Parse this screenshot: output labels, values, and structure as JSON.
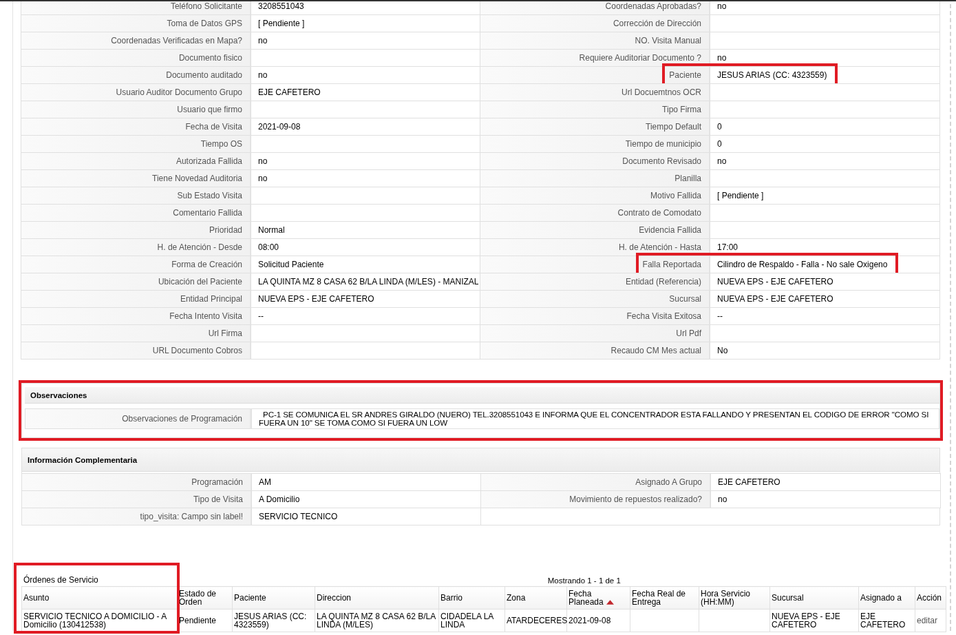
{
  "detail_rows": [
    [
      {
        "label": "Teléfono Solicitante",
        "value": "3208551043",
        "highlighted": false
      },
      {
        "label": "Coordenadas Aprobadas?",
        "value": "no",
        "highlighted": false
      }
    ],
    [
      {
        "label": "Toma de Datos GPS",
        "value": "[ Pendiente ]",
        "highlighted": false
      },
      {
        "label": "Corrección de Dirección",
        "highlighted": false
      }
    ],
    [
      {
        "label": "Coordenadas Verificadas en Mapa?",
        "value": "no",
        "highlighted": false
      },
      {
        "label": "NO. Visita Manual",
        "highlighted": false
      }
    ],
    [
      {
        "label": "Documento fisico",
        "highlighted": false
      },
      {
        "label": "Requiere Auditoriar Documento ?",
        "value": "no",
        "highlighted": false
      }
    ],
    [
      {
        "label": "Documento auditado",
        "value": "no",
        "highlighted": false
      },
      {
        "label": "Paciente",
        "value": "JESUS ARIAS (CC: 4323559)",
        "highlighted": true
      }
    ],
    [
      {
        "label": "Usuario Auditor Documento Grupo",
        "value": "EJE CAFETERO",
        "highlighted": false
      },
      {
        "label": "Url Docuemtnos OCR",
        "highlighted": false
      }
    ],
    [
      {
        "label": "Usuario que firmo",
        "highlighted": false
      },
      {
        "label": "Tipo Firma",
        "highlighted": false
      }
    ],
    [
      {
        "label": "Fecha de Visita",
        "value": "2021-09-08",
        "highlighted": false
      },
      {
        "label": "Tiempo Default",
        "value": "0",
        "highlighted": false
      }
    ],
    [
      {
        "label": "Tiempo OS",
        "highlighted": false
      },
      {
        "label": "Tiempo de municipio",
        "value": "0",
        "highlighted": false
      }
    ],
    [
      {
        "label": "Autorizada Fallida",
        "value": "no",
        "highlighted": false
      },
      {
        "label": "Documento Revisado",
        "value": "no",
        "highlighted": false
      }
    ],
    [
      {
        "label": "Tiene Novedad Auditoria",
        "value": "no",
        "highlighted": false
      },
      {
        "label": "Planilla",
        "highlighted": false
      }
    ],
    [
      {
        "label": "Sub Estado Visita",
        "highlighted": false
      },
      {
        "label": "Motivo Fallida",
        "value": "[ Pendiente ]",
        "highlighted": false
      }
    ],
    [
      {
        "label": "Comentario Fallida",
        "highlighted": false
      },
      {
        "label": "Contrato de Comodato",
        "highlighted": false
      }
    ],
    [
      {
        "label": "Prioridad",
        "value": "Normal",
        "highlighted": false
      },
      {
        "label": "Evidencia Fallida",
        "highlighted": false
      }
    ],
    [
      {
        "label": "H. de Atención - Desde",
        "value": "08:00",
        "highlighted": false
      },
      {
        "label": "H. de Atención - Hasta",
        "value": "17:00",
        "highlighted": false
      }
    ],
    [
      {
        "label": "Forma de Creación",
        "value": "Solicitud Paciente",
        "highlighted": false
      },
      {
        "label": "Falla Reportada",
        "value": "Cilindro de Respaldo - Falla - No sale Oxigeno",
        "highlighted": true
      }
    ],
    [
      {
        "label": "Ubicación del Paciente",
        "value": "LA QUINTA MZ 8 CASA 62 B/LA LINDA (M/LES) - MANIZAL",
        "highlighted": false
      },
      {
        "label": "Entidad (Referencia)",
        "value": "NUEVA EPS - EJE CAFETERO",
        "highlighted": false
      }
    ],
    [
      {
        "label": "Entidad Principal",
        "value": "NUEVA EPS - EJE CAFETERO",
        "highlighted": false
      },
      {
        "label": "Sucursal",
        "value": "NUEVA EPS - EJE CAFETERO",
        "highlighted": false
      }
    ],
    [
      {
        "label": "Fecha Intento Visita",
        "value": "--",
        "highlighted": false
      },
      {
        "label": "Fecha Visita Exitosa",
        "value": "--",
        "highlighted": false
      }
    ],
    [
      {
        "label": "Url Firma",
        "highlighted": false
      },
      {
        "label": "Url Pdf",
        "highlighted": false
      }
    ],
    [
      {
        "label": "URL Documento Cobros",
        "highlighted": false
      },
      {
        "label": "Recaudo CM Mes actual",
        "value": "No",
        "highlighted": false
      }
    ]
  ],
  "observaciones": {
    "title": "Observaciones",
    "highlighted": true,
    "label": "Observaciones de Programación",
    "value": "PC-1 SE COMUNICA EL SR ANDRES GIRALDO (NUERO) TEL.3208551043 E INFORMA QUE EL CONCENTRADOR ESTA FALLANDO Y PRESENTAN EL CODIGO DE ERROR \"COMO SI FUERA UN 10\" SE TOMA COMO SI FUERA UN LOW"
  },
  "informacion_complementaria": {
    "title": "Información Complementaria",
    "rows": [
      [
        {
          "label": "Programación",
          "value": "AM"
        },
        {
          "label": "Asignado A Grupo",
          "value": "EJE CAFETERO"
        }
      ],
      [
        {
          "label": "Tipo de Visita",
          "value": "A Domicilio"
        },
        {
          "label": "Movimiento de repuestos realizado?",
          "value": "no"
        }
      ],
      [
        {
          "label": "tipo_visita: Campo sin label!",
          "value": "SERVICIO TECNICO"
        }
      ]
    ]
  },
  "ordenes": {
    "title": "Órdenes de Servicio",
    "highlighted": true,
    "pager": "Mostrando 1 - 1 de 1",
    "columns": [
      {
        "label": "Asunto",
        "sorted": false
      },
      {
        "label": "Estado de Orden",
        "sorted": false
      },
      {
        "label": "Paciente",
        "sorted": false
      },
      {
        "label": "Direccion",
        "sorted": false
      },
      {
        "label": "Barrio",
        "sorted": false
      },
      {
        "label": "Zona",
        "sorted": false
      },
      {
        "label": "Fecha Planeada",
        "sorted": true
      },
      {
        "label": "Fecha Real de Entrega",
        "sorted": false
      },
      {
        "label": "Hora Servicio (HH:MM)",
        "sorted": false
      },
      {
        "label": "Sucursal",
        "sorted": false
      },
      {
        "label": "Asignado a",
        "sorted": false
      },
      {
        "label": "Acción",
        "sorted": false
      }
    ],
    "rows": [
      [
        "SERVICIO TECNICO A DOMICILIO - A Domicilio (130412538)",
        "Pendiente",
        "JESUS ARIAS (CC: 4323559)",
        "LA QUINTA MZ 8 CASA 62 B/LA LINDA (M/LES)",
        "CIDADELA LA LINDA",
        "ATARDECERES",
        "2021-09-08",
        null,
        null,
        "NUEVA EPS - EJE CAFETERO",
        "EJE CAFETERO",
        "editar"
      ]
    ]
  }
}
